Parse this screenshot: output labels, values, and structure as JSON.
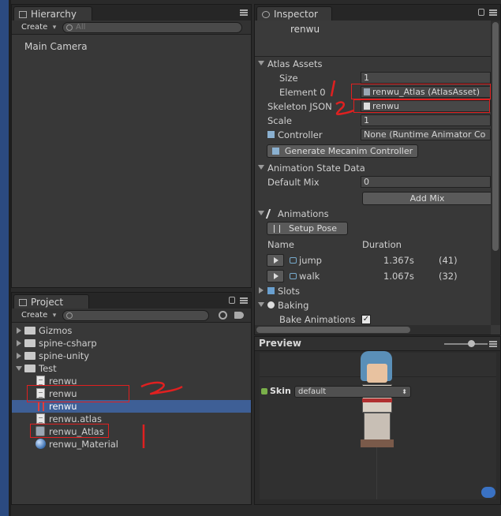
{
  "hierarchy": {
    "tab_label": "Hierarchy",
    "create_label": "Create",
    "search_placeholder": "All",
    "items": [
      {
        "label": "Main Camera"
      }
    ]
  },
  "project": {
    "tab_label": "Project",
    "create_label": "Create",
    "tree": [
      {
        "label": "Gizmos",
        "kind": "folder",
        "expanded": false
      },
      {
        "label": "spine-csharp",
        "kind": "folder",
        "expanded": false
      },
      {
        "label": "spine-unity",
        "kind": "folder",
        "expanded": false
      },
      {
        "label": "Test",
        "kind": "folder",
        "expanded": true
      },
      {
        "label": "renwu",
        "kind": "text"
      },
      {
        "label": "renwu",
        "kind": "json"
      },
      {
        "label": "renwu",
        "kind": "skeleton",
        "selected": true
      },
      {
        "label": "renwu.atlas",
        "kind": "text"
      },
      {
        "label": "renwu_Atlas",
        "kind": "atlas-asset"
      },
      {
        "label": "renwu_Material",
        "kind": "material"
      }
    ]
  },
  "inspector": {
    "tab_label": "Inspector",
    "object_name": "renwu",
    "atlas_assets": {
      "header": "Atlas Assets",
      "size_label": "Size",
      "size_value": "1",
      "element0_label": "Element 0",
      "element0_value": "renwu_Atlas (AtlasAsset)"
    },
    "skeleton_json_label": "Skeleton JSON",
    "skeleton_json_value": "renwu",
    "scale_label": "Scale",
    "scale_value": "1",
    "controller_label": "Controller",
    "controller_value": "None (Runtime Animator Co",
    "generate_button": "Generate Mecanim Controller",
    "animation_state": {
      "header": "Animation State Data",
      "default_mix_label": "Default Mix",
      "default_mix_value": "0",
      "add_mix_button": "Add Mix"
    },
    "animations": {
      "header": "Animations",
      "setup_pose_button": "Setup Pose",
      "col_name": "Name",
      "col_duration": "Duration",
      "rows": [
        {
          "name": "jump",
          "duration": "1.367s",
          "frames": "(41)"
        },
        {
          "name": "walk",
          "duration": "1.067s",
          "frames": "(32)"
        }
      ]
    },
    "slots_header": "Slots",
    "baking": {
      "header": "Baking",
      "bake_animations_label": "Bake Animations",
      "bake_animations_checked": true
    }
  },
  "preview": {
    "title": "Preview",
    "skin_label": "Skin",
    "skin_value": "default"
  },
  "colors": {
    "selection": "#3e5f96",
    "annotation": "#e02020"
  }
}
